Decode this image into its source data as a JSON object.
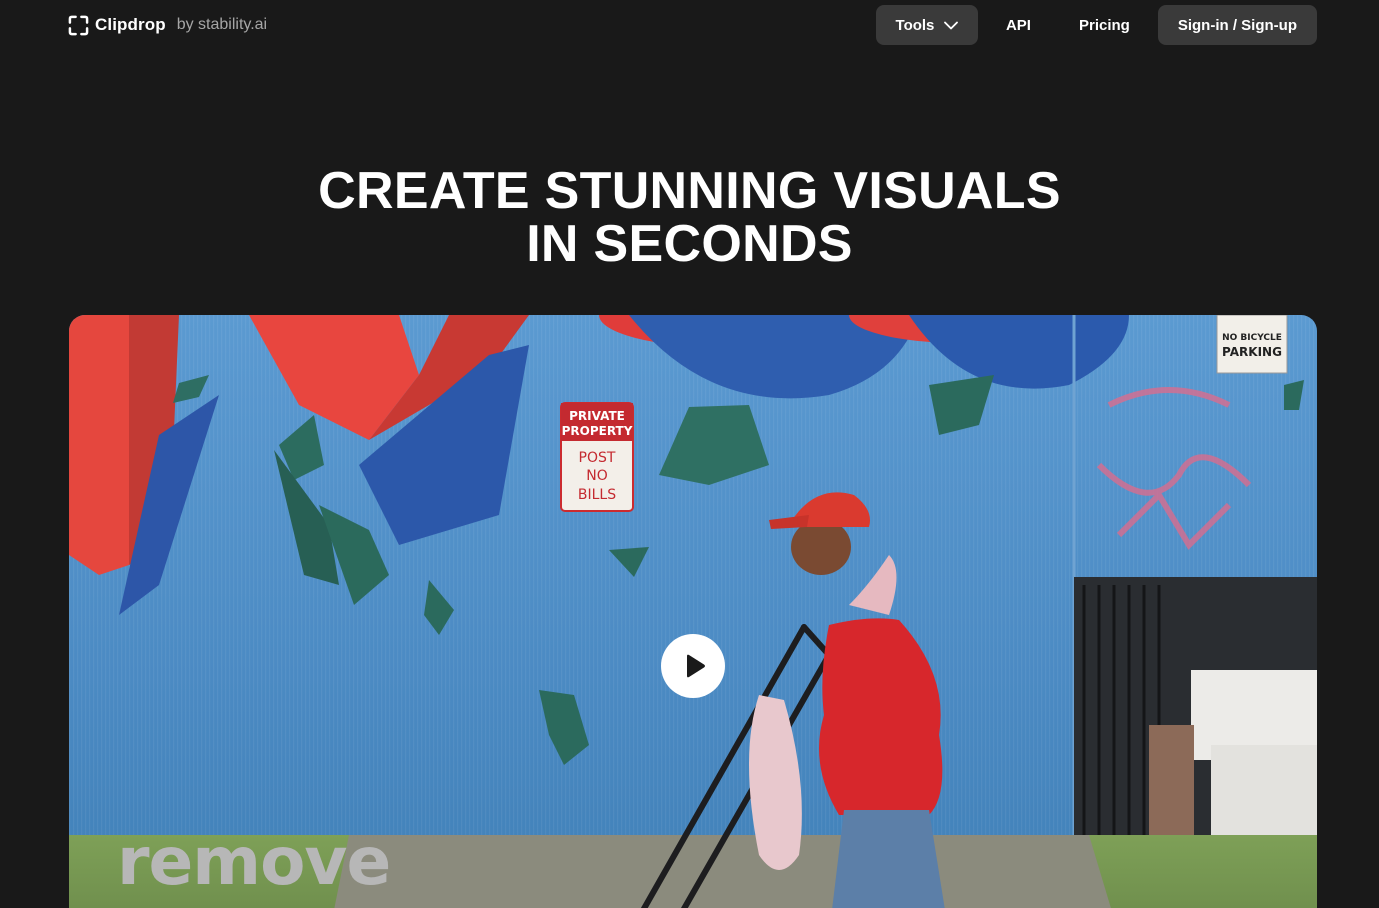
{
  "nav": {
    "brand": "Clipdrop",
    "brand_sub": "by stability.ai",
    "tools_label": "Tools",
    "api_label": "API",
    "pricing_label": "Pricing",
    "sign_label": "Sign-in / Sign-up"
  },
  "hero": {
    "line1": "CREATE STUNNING VISUALS",
    "line2": "IN SECONDS"
  },
  "video": {
    "caption": "remove",
    "sign_private_1": "PRIVATE",
    "sign_private_2": "PROPERTY",
    "sign_post": "POST",
    "sign_no": "NO",
    "sign_bills": "BILLS",
    "sign_bicycle_1": "NO BICYCLE",
    "sign_bicycle_2": "PARKING"
  },
  "colors": {
    "background": "#191919",
    "button_bg": "#3a3a3a",
    "wall_blue": "#4f8fc7",
    "mural_red": "#e2463f",
    "jacket_red": "#d8242a"
  }
}
